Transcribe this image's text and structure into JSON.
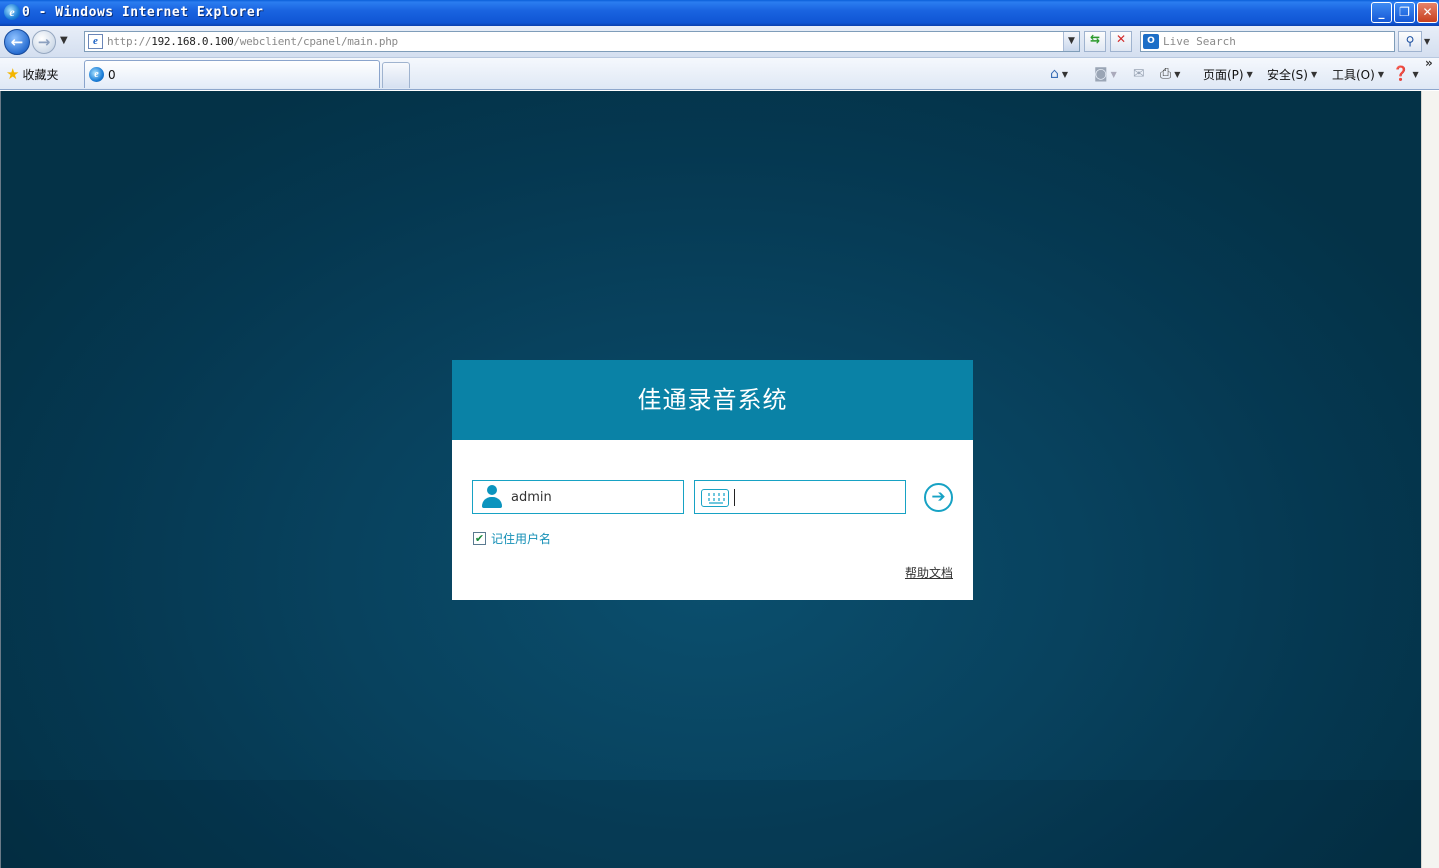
{
  "window": {
    "title": "0 - Windows Internet Explorer",
    "controls": {
      "minimize": "_",
      "maximize": "❐",
      "close": "✕"
    }
  },
  "address_bar": {
    "url_prefix": "http://",
    "url_host": "192.168.0.100",
    "url_path": "/webclient/cpanel/main.php"
  },
  "search": {
    "placeholder": "Live Search",
    "provider_icon": "O"
  },
  "toolbar": {
    "favorites_label": "收藏夹",
    "tab_title": "0",
    "page_menu": "页面(P)",
    "safety_menu": "安全(S)",
    "tools_menu": "工具(O)"
  },
  "login": {
    "title": "佳通录音系统",
    "username_value": "admin",
    "remember_label": "记住用户名",
    "remember_checked": true,
    "help_link": "帮助文档"
  },
  "colors": {
    "header_bg": "#0a82a6",
    "accent": "#17a2c4",
    "page_bg": "#053851"
  },
  "icons": [
    "ie-logo-icon",
    "back-arrow-icon",
    "forward-arrow-icon",
    "refresh-icon",
    "stop-icon",
    "search-icon",
    "star-icon",
    "home-icon",
    "feed-icon",
    "mail-icon",
    "print-icon",
    "help-icon",
    "user-icon",
    "keyboard-icon",
    "arrow-right-icon"
  ]
}
